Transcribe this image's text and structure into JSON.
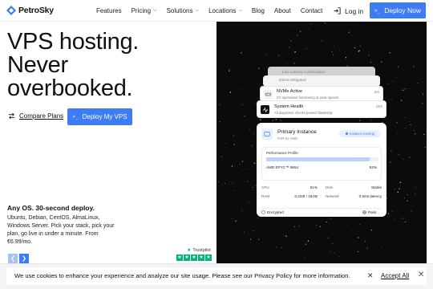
{
  "header": {
    "brand": "PetroSky",
    "nav": [
      {
        "label": "Features",
        "dropdown": false
      },
      {
        "label": "Pricing",
        "dropdown": true
      },
      {
        "label": "Solutions",
        "dropdown": true
      },
      {
        "label": "Locations",
        "dropdown": true
      },
      {
        "label": "Blog",
        "dropdown": false
      },
      {
        "label": "About",
        "dropdown": false
      },
      {
        "label": "Contact",
        "dropdown": false
      }
    ],
    "login_label": "Log in",
    "deploy_label": "Deploy Now",
    "accent": "#3d7cf2"
  },
  "hero": {
    "title_lines": [
      "VPS hosting.",
      "Never",
      "overbooked."
    ],
    "compare_label": "Compare Plans",
    "deploy_label": "Deploy My VPS",
    "sub_heading": "Any OS. 30-second deploy.",
    "sub_text": "Ubuntu, Debian, CentOS, AlmaLinux, Windows Server. Pick your stack, pick your plan, go live in under a minute. From €6.99/mo.",
    "trustpilot_label": "Trustpilot",
    "trustpilot_stars": 5
  },
  "panel": {
    "stack_cards": [
      {
        "title": "Low Latency Confirmation"
      },
      {
        "title": "DDoS Mitigated"
      },
      {
        "title": "NVMe Active",
        "subtitle": "I/O operations functioning at peak speeds",
        "time": "5m"
      },
      {
        "title": "System Health",
        "subtitle": "All diagnostic checks passed flawlessly",
        "time": "12m"
      }
    ],
    "instance": {
      "title": "Primary Instance",
      "id": "PAR-01-AMD",
      "badge": "Instance running",
      "profile_label": "Performance Profile",
      "cpu_model": "AMD EPYC™ 9654",
      "cpu_score_label": "92%",
      "cpu_score_fraction": 0.92,
      "stats": {
        "cpu_label": "CPU",
        "cpu_value": "91%",
        "disk_label": "Disk",
        "disk_value": "Stable",
        "ram_label": "RAM",
        "ram_value": "6.2GB / 16GB",
        "network_label": "Network",
        "network_value": "0.5ms latency"
      },
      "footer_left": "Encrypted",
      "footer_right": "Paris"
    }
  },
  "cookie": {
    "text": "We use cookies to enhance your experience and analyze our site usage. Please see our Privacy Policy for more information.",
    "accept_label": "Accept All"
  }
}
